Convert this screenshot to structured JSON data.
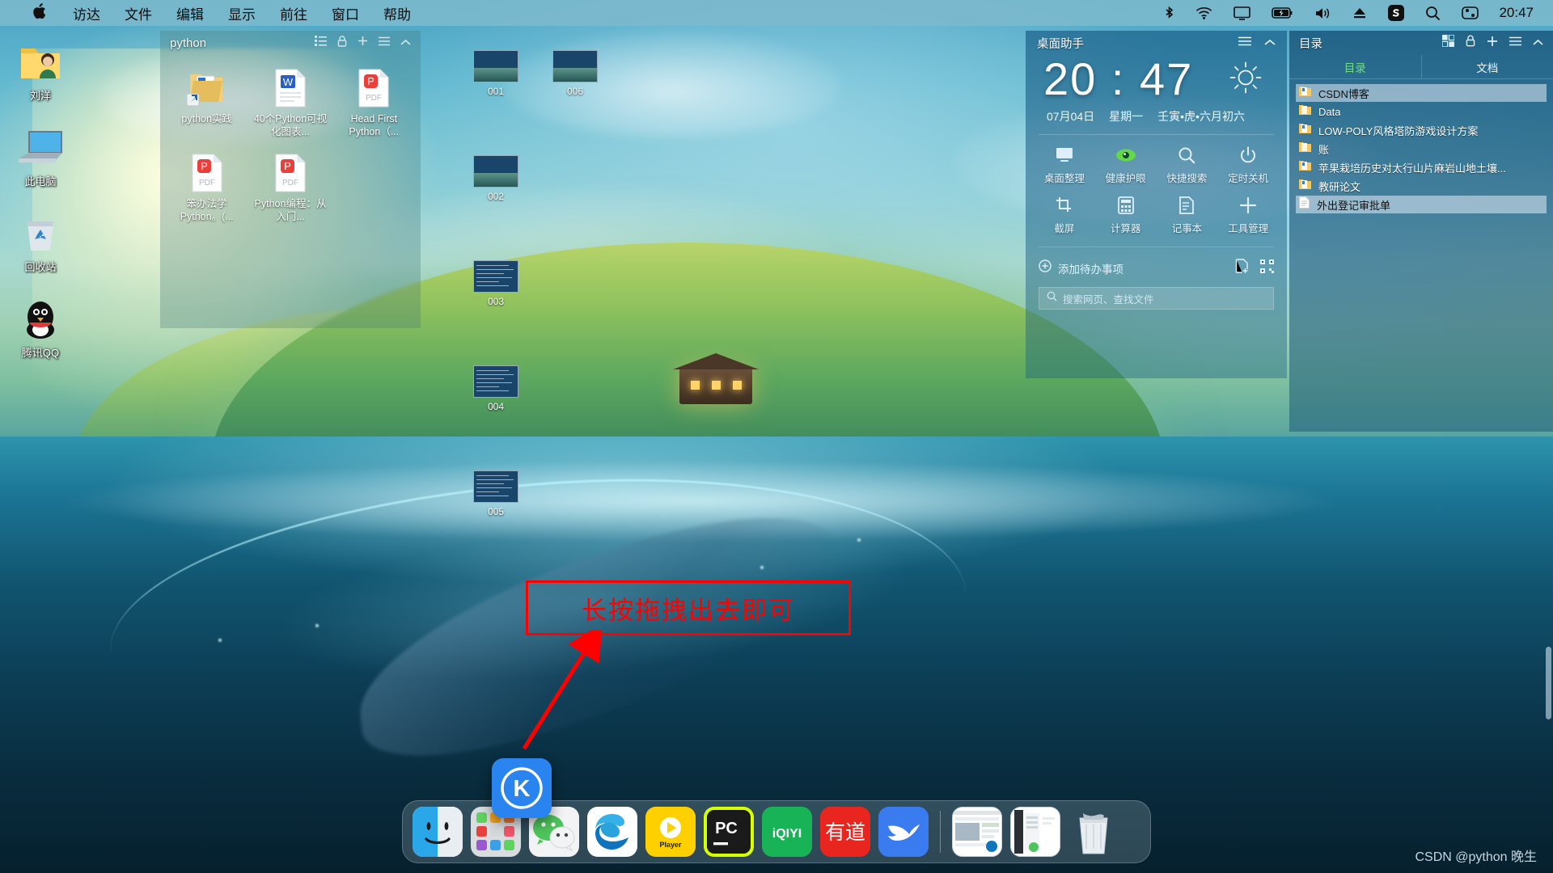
{
  "menubar": {
    "apple_icon": "apple-logo-icon",
    "items": [
      "访达",
      "文件",
      "编辑",
      "显示",
      "前往",
      "窗口",
      "帮助"
    ],
    "status_icons": [
      "bluetooth-icon",
      "wifi-icon",
      "display-icon",
      "battery-icon",
      "volume-icon",
      "eject-icon",
      "sogou-input-icon",
      "search-icon",
      "control-center-icon"
    ],
    "clock": "20:47"
  },
  "desktop_icons": [
    {
      "label": "刘洋",
      "icon": "user-folder-icon"
    },
    {
      "label": "此电脑",
      "icon": "computer-icon"
    },
    {
      "label": "回收站",
      "icon": "recycle-bin-icon"
    },
    {
      "label": "腾讯QQ",
      "icon": "qq-penguin-icon"
    }
  ],
  "folder_window": {
    "title": "python",
    "tool_icons": [
      "list-view-icon",
      "lock-icon",
      "plus-icon",
      "menu-icon",
      "collapse-icon"
    ],
    "items": [
      {
        "name": "python实践",
        "icon": "folder-shortcut-icon"
      },
      {
        "name": "40个Python可视化图表...",
        "icon": "word-doc-icon"
      },
      {
        "name": "Head First Python（...",
        "icon": "pdf-icon"
      },
      {
        "name": "笨办法学Python。(...",
        "icon": "pdf-icon"
      },
      {
        "name": "Python编程：从入门...",
        "icon": "pdf-icon"
      }
    ]
  },
  "desktop_files": [
    {
      "name": "001",
      "kind": "picture"
    },
    {
      "name": "006",
      "kind": "picture"
    },
    {
      "name": "002",
      "kind": "picture"
    },
    {
      "name": "003",
      "kind": "document"
    },
    {
      "name": "004",
      "kind": "document"
    },
    {
      "name": "005",
      "kind": "document"
    }
  ],
  "assistant": {
    "title": "桌面助手",
    "head_icons": [
      "menu-icon",
      "collapse-icon"
    ],
    "time": "20 : 47",
    "weather_icon": "sun-icon",
    "date": "07月04日",
    "weekday": "星期一",
    "lunar": "壬寅•虎•六月初六",
    "tools": [
      {
        "label": "桌面整理",
        "icon": "desktop-tidy-icon"
      },
      {
        "label": "健康护眼",
        "icon": "eye-care-icon"
      },
      {
        "label": "快捷搜索",
        "icon": "search-icon"
      },
      {
        "label": "定时关机",
        "icon": "power-icon"
      },
      {
        "label": "截屏",
        "icon": "screenshot-icon"
      },
      {
        "label": "计算器",
        "icon": "calculator-icon"
      },
      {
        "label": "记事本",
        "icon": "notepad-icon"
      },
      {
        "label": "工具管理",
        "icon": "plus-icon"
      }
    ],
    "todo_label": "添加待办事项",
    "todo_icons": [
      "note-add-icon",
      "qrcode-icon"
    ],
    "search_placeholder": "搜索网页、查找文件"
  },
  "directory_panel": {
    "title": "目录",
    "head_icons": [
      "grid-icon",
      "lock-icon",
      "plus-icon",
      "menu-icon",
      "collapse-icon"
    ],
    "tabs": [
      {
        "label": "目录",
        "active": true
      },
      {
        "label": "文档",
        "active": false
      }
    ],
    "rows": [
      {
        "label": "CSDN博客",
        "icon": "folder-icon",
        "selected": true
      },
      {
        "label": "Data",
        "icon": "folder-icon",
        "selected": false
      },
      {
        "label": "LOW-POLY风格塔防游戏设计方案",
        "icon": "folder-icon",
        "selected": false
      },
      {
        "label": "账",
        "icon": "folder-icon",
        "selected": false
      },
      {
        "label": "苹果栽培历史对太行山片麻岩山地土壤...",
        "icon": "folder-icon",
        "selected": false
      },
      {
        "label": "教研论文",
        "icon": "folder-icon",
        "selected": false
      },
      {
        "label": "外出登记审批单",
        "icon": "document-icon",
        "selected": true
      }
    ]
  },
  "annotation": {
    "text": "长按拖拽出去即可",
    "color": "#ff0000"
  },
  "drag_icon": {
    "name": "kingsoft-k-icon",
    "letter": "K",
    "color": "#2a84f0"
  },
  "dock": {
    "apps": [
      {
        "name": "finder-icon",
        "label": "Finder"
      },
      {
        "name": "launchpad-icon",
        "label": "启动台"
      },
      {
        "name": "wechat-icon",
        "label": "微信"
      },
      {
        "name": "edge-icon",
        "label": "Microsoft Edge"
      },
      {
        "name": "player-icon",
        "label": "Player"
      },
      {
        "name": "pycharm-icon",
        "label": "PC"
      },
      {
        "name": "iqiyi-icon",
        "label": "iQIYI"
      },
      {
        "name": "youdao-icon",
        "label": "有道"
      },
      {
        "name": "bird-icon",
        "label": "飞书"
      }
    ],
    "minimized": [
      {
        "name": "edge-window-thumb",
        "label": "Edge 窗口"
      },
      {
        "name": "wechat-window-thumb",
        "label": "微信窗口"
      }
    ],
    "trash": {
      "name": "trash-icon",
      "label": "废纸篓"
    }
  },
  "watermark": "CSDN @python 晚生"
}
